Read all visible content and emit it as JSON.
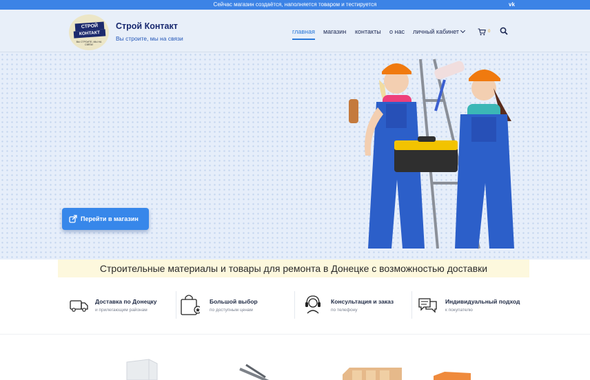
{
  "topbar": {
    "message": "Сейчас магазин создаётся, наполняется товаром и тестируется",
    "social": "vk"
  },
  "brand": {
    "logo_line1": "СТРОЙ",
    "logo_line2": "КОНТАКТ",
    "logo_line3": "ВЫ СТРОИТЕ, МЫ НА СВЯЗИ",
    "title": "Строй Контакт",
    "tagline": "Вы строите, мы на связи"
  },
  "nav": {
    "items": [
      "главная",
      "магазин",
      "контакты",
      "о нас",
      "личный кабинет"
    ],
    "active_index": 0,
    "cart_count": "0"
  },
  "hero": {
    "button_label": "Перейти в магазин"
  },
  "tagline": "Строительные материалы и товары для ремонта в Донецке с возможностью доставки",
  "features": [
    {
      "title": "Доставка по Донецку",
      "subtitle": "и прилегающим районам",
      "icon": "truck-icon"
    },
    {
      "title": "Большой выбор",
      "subtitle": "по доступным ценам",
      "icon": "shopping-bag-icon"
    },
    {
      "title": "Консультация и заказ",
      "subtitle": "по телефону",
      "icon": "headset-icon"
    },
    {
      "title": "Индивидуальный подход",
      "subtitle": "к покупателю",
      "icon": "chat-icon"
    }
  ],
  "colors": {
    "accent": "#3c83e6",
    "brand_dark": "#17286f",
    "tagline_bg": "#fdf8dd",
    "hero_bg": "#e6eefa"
  }
}
